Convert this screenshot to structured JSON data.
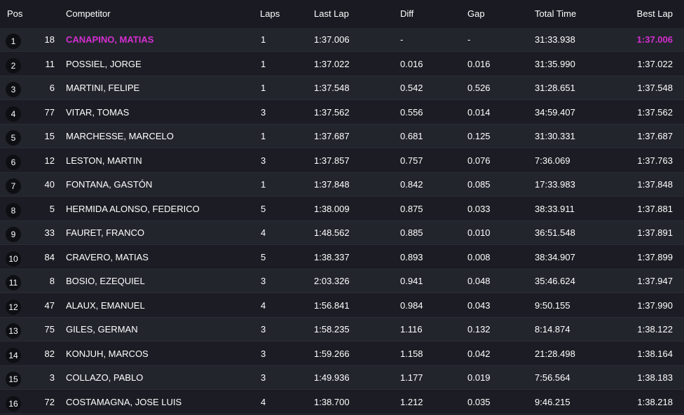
{
  "header": {
    "pos": "Pos",
    "competitor": "Competitor",
    "laps": "Laps",
    "last_lap": "Last Lap",
    "diff": "Diff",
    "gap": "Gap",
    "total_time": "Total Time",
    "best_lap": "Best Lap"
  },
  "colors": {
    "highlight": "#d42fd0",
    "background": "#1a1b22"
  },
  "rows": [
    {
      "pos": "1",
      "num": "18",
      "name": "CANAPINO, MATIAS",
      "laps": "1",
      "last": "1:37.006",
      "diff": "-",
      "gap": "-",
      "total": "31:33.938",
      "best": "1:37.006"
    },
    {
      "pos": "2",
      "num": "11",
      "name": "POSSIEL, JORGE",
      "laps": "1",
      "last": "1:37.022",
      "diff": "0.016",
      "gap": "0.016",
      "total": "31:35.990",
      "best": "1:37.022"
    },
    {
      "pos": "3",
      "num": "6",
      "name": "MARTINI, FELIPE",
      "laps": "1",
      "last": "1:37.548",
      "diff": "0.542",
      "gap": "0.526",
      "total": "31:28.651",
      "best": "1:37.548"
    },
    {
      "pos": "4",
      "num": "77",
      "name": "VITAR, TOMAS",
      "laps": "3",
      "last": "1:37.562",
      "diff": "0.556",
      "gap": "0.014",
      "total": "34:59.407",
      "best": "1:37.562"
    },
    {
      "pos": "5",
      "num": "15",
      "name": "MARCHESSE, MARCELO",
      "laps": "1",
      "last": "1:37.687",
      "diff": "0.681",
      "gap": "0.125",
      "total": "31:30.331",
      "best": "1:37.687"
    },
    {
      "pos": "6",
      "num": "12",
      "name": "LESTON, MARTIN",
      "laps": "3",
      "last": "1:37.857",
      "diff": "0.757",
      "gap": "0.076",
      "total": "7:36.069",
      "best": "1:37.763"
    },
    {
      "pos": "7",
      "num": "40",
      "name": "FONTANA, GASTÓN",
      "laps": "1",
      "last": "1:37.848",
      "diff": "0.842",
      "gap": "0.085",
      "total": "17:33.983",
      "best": "1:37.848"
    },
    {
      "pos": "8",
      "num": "5",
      "name": "HERMIDA ALONSO, FEDERICO",
      "laps": "5",
      "last": "1:38.009",
      "diff": "0.875",
      "gap": "0.033",
      "total": "38:33.911",
      "best": "1:37.881"
    },
    {
      "pos": "9",
      "num": "33",
      "name": "FAURET, FRANCO",
      "laps": "4",
      "last": "1:48.562",
      "diff": "0.885",
      "gap": "0.010",
      "total": "36:51.548",
      "best": "1:37.891"
    },
    {
      "pos": "10",
      "num": "84",
      "name": "CRAVERO, MATIAS",
      "laps": "5",
      "last": "1:38.337",
      "diff": "0.893",
      "gap": "0.008",
      "total": "38:34.907",
      "best": "1:37.899"
    },
    {
      "pos": "11",
      "num": "8",
      "name": "BOSIO, EZEQUIEL",
      "laps": "3",
      "last": "2:03.326",
      "diff": "0.941",
      "gap": "0.048",
      "total": "35:46.624",
      "best": "1:37.947"
    },
    {
      "pos": "12",
      "num": "47",
      "name": "ALAUX, EMANUEL",
      "laps": "4",
      "last": "1:56.841",
      "diff": "0.984",
      "gap": "0.043",
      "total": "9:50.155",
      "best": "1:37.990"
    },
    {
      "pos": "13",
      "num": "75",
      "name": "GILES, GERMAN",
      "laps": "3",
      "last": "1:58.235",
      "diff": "1.116",
      "gap": "0.132",
      "total": "8:14.874",
      "best": "1:38.122"
    },
    {
      "pos": "14",
      "num": "82",
      "name": "KONJUH, MARCOS",
      "laps": "3",
      "last": "1:59.266",
      "diff": "1.158",
      "gap": "0.042",
      "total": "21:28.498",
      "best": "1:38.164"
    },
    {
      "pos": "15",
      "num": "3",
      "name": "COLLAZO, PABLO",
      "laps": "3",
      "last": "1:49.936",
      "diff": "1.177",
      "gap": "0.019",
      "total": "7:56.564",
      "best": "1:38.183"
    },
    {
      "pos": "16",
      "num": "72",
      "name": "COSTAMAGNA, JOSE LUIS",
      "laps": "4",
      "last": "1:38.700",
      "diff": "1.212",
      "gap": "0.035",
      "total": "9:46.215",
      "best": "1:38.218"
    }
  ]
}
